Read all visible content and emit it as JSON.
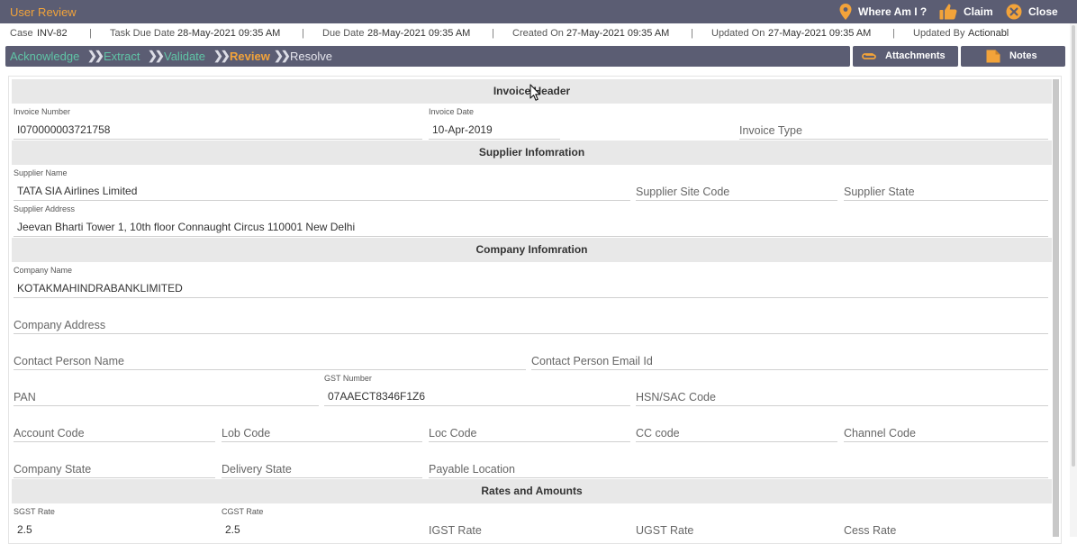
{
  "app": {
    "title": "User Review"
  },
  "top_actions": {
    "where_am_i": "Where Am I ?",
    "claim": "Claim",
    "close": "Close"
  },
  "meta": {
    "case_label": "Case",
    "case_value": "INV-82",
    "task_due_label": "Task Due Date",
    "task_due_value": "28-May-2021 09:35 AM",
    "due_label": "Due Date",
    "due_value": "28-May-2021 09:35 AM",
    "created_label": "Created On",
    "created_value": "27-May-2021 09:35 AM",
    "updated_label": "Updated On",
    "updated_value": "27-May-2021 09:35 AM",
    "updated_by_label": "Updated By",
    "updated_by_value": "Actionabl",
    "separator": "|"
  },
  "workflow": {
    "steps": [
      {
        "label": "Acknowledge",
        "state": "done"
      },
      {
        "label": "Extract",
        "state": "done"
      },
      {
        "label": "Validate",
        "state": "done"
      },
      {
        "label": "Review",
        "state": "current"
      },
      {
        "label": "Resolve",
        "state": "pending"
      }
    ],
    "chevron": "❯❯"
  },
  "header_buttons": {
    "attachments": "Attachments",
    "notes": "Notes"
  },
  "colors": {
    "bar": "#5b5d73",
    "done": "#5fc4a6",
    "current": "#f2a33a",
    "pending": "#e6e6ee",
    "accent": "#f2a33a"
  },
  "sections": {
    "invoice_header": "Invoice Header",
    "supplier_info": "Supplier Infomration",
    "company_info": "Company Infomration",
    "rates_amounts": "Rates and Amounts"
  },
  "fields": {
    "invoice_number": {
      "label": "Invoice Number",
      "value": "I070000003721758"
    },
    "invoice_date": {
      "label": "Invoice Date",
      "value": "10-Apr-2019"
    },
    "invoice_type": {
      "placeholder": "Invoice Type"
    },
    "supplier_name": {
      "label": "Supplier Name",
      "value": "TATA SIA Airlines Limited"
    },
    "supplier_site_code": {
      "placeholder": "Supplier Site Code"
    },
    "supplier_state": {
      "placeholder": "Supplier State"
    },
    "supplier_address": {
      "label": "Supplier Address",
      "value": "Jeevan Bharti Tower 1, 10th floor Connaught Circus 110001 New Delhi"
    },
    "company_name": {
      "label": "Company Name",
      "value": "KOTAKMAHINDRABANKLIMITED"
    },
    "company_address": {
      "placeholder": "Company Address"
    },
    "contact_person_name": {
      "placeholder": "Contact Person Name"
    },
    "contact_person_email": {
      "placeholder": "Contact Person Email Id"
    },
    "pan": {
      "placeholder": "PAN"
    },
    "gst_number": {
      "label": "GST Number",
      "value": "07AAECT8346F1Z6"
    },
    "hsn_sac_code": {
      "placeholder": "HSN/SAC Code"
    },
    "account_code": {
      "placeholder": "Account Code"
    },
    "lob_code": {
      "placeholder": "Lob Code"
    },
    "loc_code": {
      "placeholder": "Loc Code"
    },
    "cc_code": {
      "placeholder": "CC code"
    },
    "channel_code": {
      "placeholder": "Channel Code"
    },
    "company_state": {
      "placeholder": "Company State"
    },
    "delivery_state": {
      "placeholder": "Delivery State"
    },
    "payable_location": {
      "placeholder": "Payable Location"
    },
    "sgst_rate": {
      "label": "SGST Rate",
      "value": "2.5"
    },
    "cgst_rate": {
      "label": "CGST Rate",
      "value": "2.5"
    },
    "igst_rate": {
      "placeholder": "IGST Rate"
    },
    "ugst_rate": {
      "placeholder": "UGST Rate"
    },
    "cess_rate": {
      "placeholder": "Cess Rate"
    }
  }
}
